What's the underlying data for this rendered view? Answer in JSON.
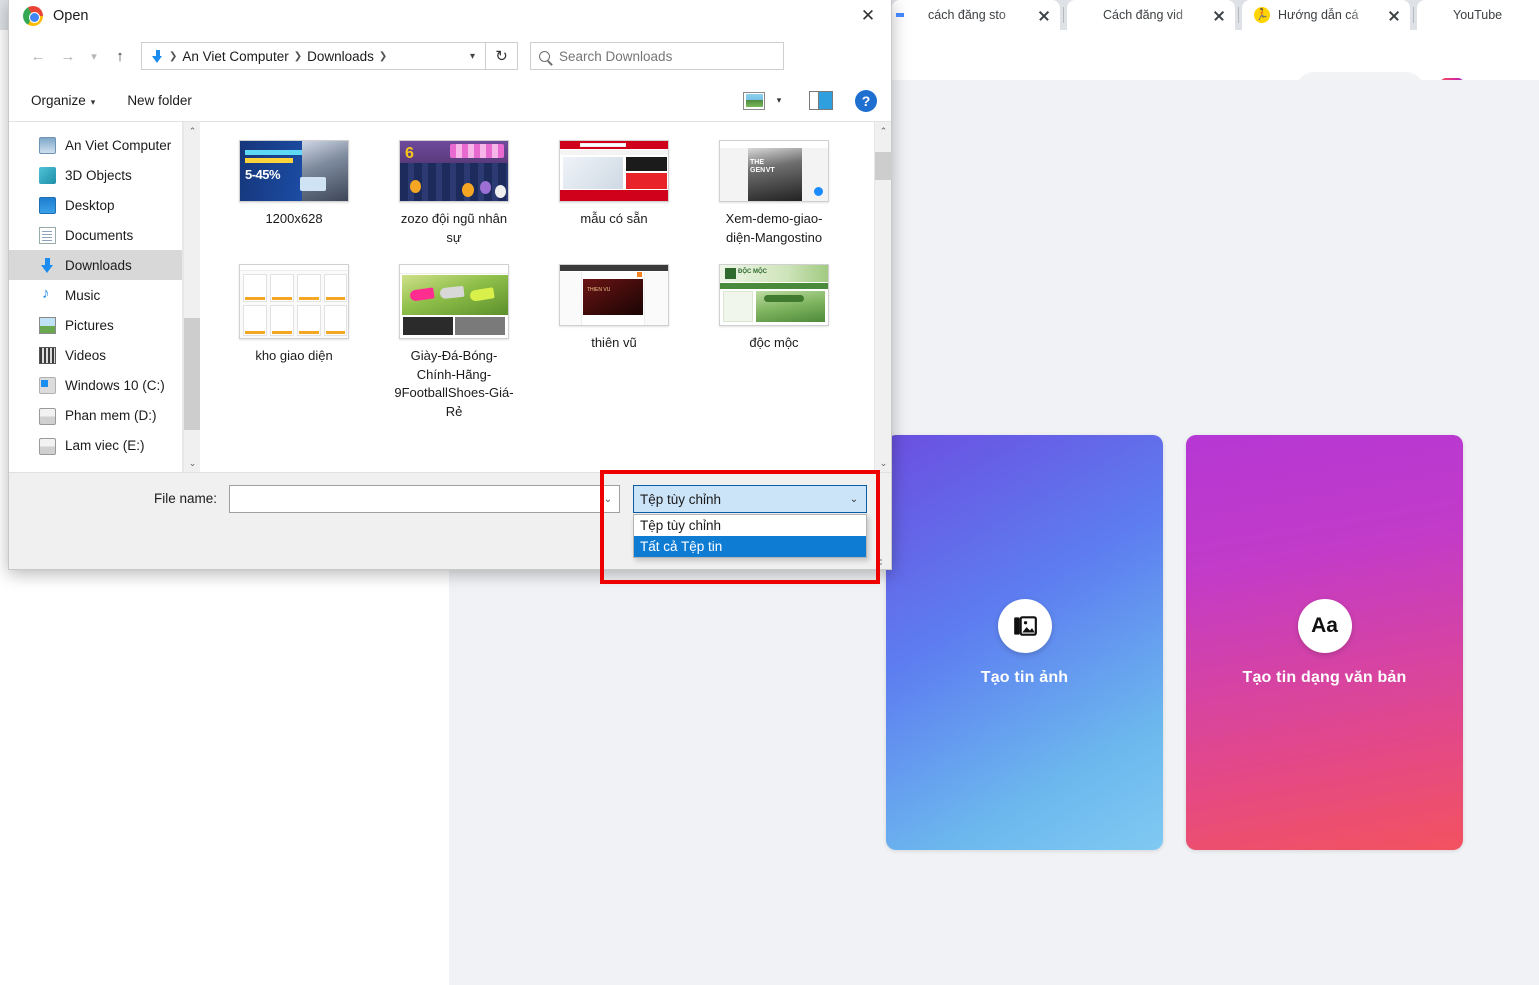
{
  "browser": {
    "tabs": [
      {
        "title": "cách đăng sto",
        "favicon": "google-icon",
        "has_close": true
      },
      {
        "title": "Cách đăng vid",
        "favicon": "youtube-icon",
        "has_close": true
      },
      {
        "title": "Hướng dẫn cá",
        "favicon": "runner-icon",
        "has_close": true
      },
      {
        "title": "YouTube",
        "favicon": "youtube-icon",
        "has_close": false
      }
    ],
    "toolbar_icons": [
      "open-in-new-icon",
      "share-icon",
      "star-icon",
      "instagram-extension-icon",
      "blue-extension-icon",
      "gear-icon"
    ]
  },
  "page": {
    "cards": [
      {
        "label": "Tạo tin ảnh",
        "icon": "photo-icon",
        "gradient_from": "#6b4fe0",
        "gradient_to": "#7fc9f2"
      },
      {
        "label": "Tạo tin dạng văn bản",
        "icon": "aa-text-icon",
        "gradient_from": "#b537d4",
        "gradient_to": "#f3525f"
      }
    ]
  },
  "dialog": {
    "title": "Open",
    "app_icon": "chrome-icon",
    "close_label": "✕",
    "nav": {
      "back_icon": "arrow-left-icon",
      "forward_icon": "arrow-right-icon",
      "recent_icon": "chevron-down-icon",
      "up_icon": "arrow-up-icon",
      "breadcrumb": [
        "An Viet Computer",
        "Downloads"
      ],
      "breadcrumb_icon": "downloads-arrow-icon",
      "breadcrumb_caret": "⌄",
      "refresh_icon": "refresh-icon",
      "refresh_glyph": "↻",
      "search_placeholder": "Search Downloads",
      "search_value": "",
      "search_icon": "search-icon"
    },
    "command_bar": {
      "organize_label": "Organize",
      "organize_caret": "▾",
      "new_folder_label": "New folder",
      "view_icon": "view-options-icon",
      "view_caret": "▾",
      "preview_pane_icon": "preview-pane-icon",
      "help_icon": "help-icon",
      "help_glyph": "?"
    },
    "sidebar": {
      "items": [
        {
          "label": "An Viet Computer",
          "icon": "computer-icon",
          "selected": false
        },
        {
          "label": "3D Objects",
          "icon": "cube-icon",
          "selected": false
        },
        {
          "label": "Desktop",
          "icon": "desktop-icon",
          "selected": false
        },
        {
          "label": "Documents",
          "icon": "document-icon",
          "selected": false
        },
        {
          "label": "Downloads",
          "icon": "download-icon",
          "selected": true
        },
        {
          "label": "Music",
          "icon": "music-note-icon",
          "selected": false
        },
        {
          "label": "Pictures",
          "icon": "picture-icon",
          "selected": false
        },
        {
          "label": "Videos",
          "icon": "video-icon",
          "selected": false
        },
        {
          "label": "Windows 10 (C:)",
          "icon": "windows-drive-icon",
          "selected": false
        },
        {
          "label": "Phan mem (D:)",
          "icon": "drive-icon",
          "selected": false
        },
        {
          "label": "Lam viec (E:)",
          "icon": "drive-icon",
          "selected": false
        }
      ],
      "scroll_up_glyph": "⌃",
      "scroll_down_glyph": "⌄"
    },
    "files": [
      {
        "name": "1200x628",
        "art": "t1"
      },
      {
        "name": "zozo đội ngũ nhân sự",
        "art": "t2"
      },
      {
        "name": "mẫu có sẵn",
        "art": "t3"
      },
      {
        "name": "Xem-demo-giao-diện-Mangostino",
        "art": "t4"
      },
      {
        "name": "kho giao diện",
        "art": "t5"
      },
      {
        "name": "Giày-Đá-Bóng-Chính-Hãng-9FootballShoes-Giá-Rẻ",
        "art": "t6"
      },
      {
        "name": "thiên vũ",
        "art": "t7"
      },
      {
        "name": "độc mộc",
        "art": "t8"
      }
    ],
    "footer": {
      "file_name_label": "File name:",
      "file_name_value": "",
      "file_name_caret": "⌄",
      "filter": {
        "selected": "Tệp tùy chỉnh",
        "caret": "⌄",
        "options": [
          {
            "label": "Tệp tùy chỉnh",
            "highlighted": false
          },
          {
            "label": "Tất cả Tệp tin",
            "highlighted": true
          }
        ]
      },
      "highlight_color": "#ee0000"
    }
  }
}
